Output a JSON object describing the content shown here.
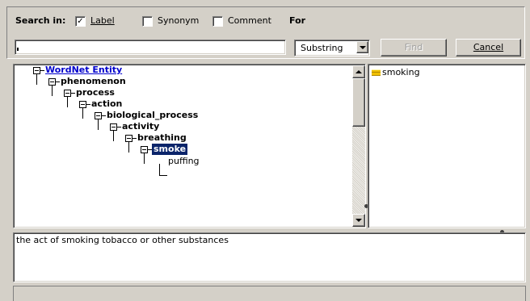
{
  "search": {
    "label": "Search in:",
    "options": [
      {
        "label": "Label",
        "checked": true
      },
      {
        "label": "Synonym",
        "checked": false
      },
      {
        "label": "Comment",
        "checked": false
      }
    ],
    "for_label": "For",
    "query_value": "",
    "match_mode": "Substring",
    "find_label": "Find",
    "cancel_label": "Cancel"
  },
  "tree": {
    "nodes": [
      {
        "label": "WordNet Entity"
      },
      {
        "label": "phenomenon"
      },
      {
        "label": "process"
      },
      {
        "label": "action"
      },
      {
        "label": "biological_process"
      },
      {
        "label": "activity"
      },
      {
        "label": "breathing"
      },
      {
        "label": "smoke"
      },
      {
        "label": "puffing"
      }
    ]
  },
  "synonyms": {
    "items": [
      {
        "label": "smoking",
        "icon": "synonym-icon"
      }
    ]
  },
  "comment": {
    "text": "the act of smoking tobacco or other substances"
  },
  "colors": {
    "link": "#0000cc",
    "selection": "#0a246a",
    "face": "#d4d0c8",
    "synonym_icon": "#f0c000"
  }
}
